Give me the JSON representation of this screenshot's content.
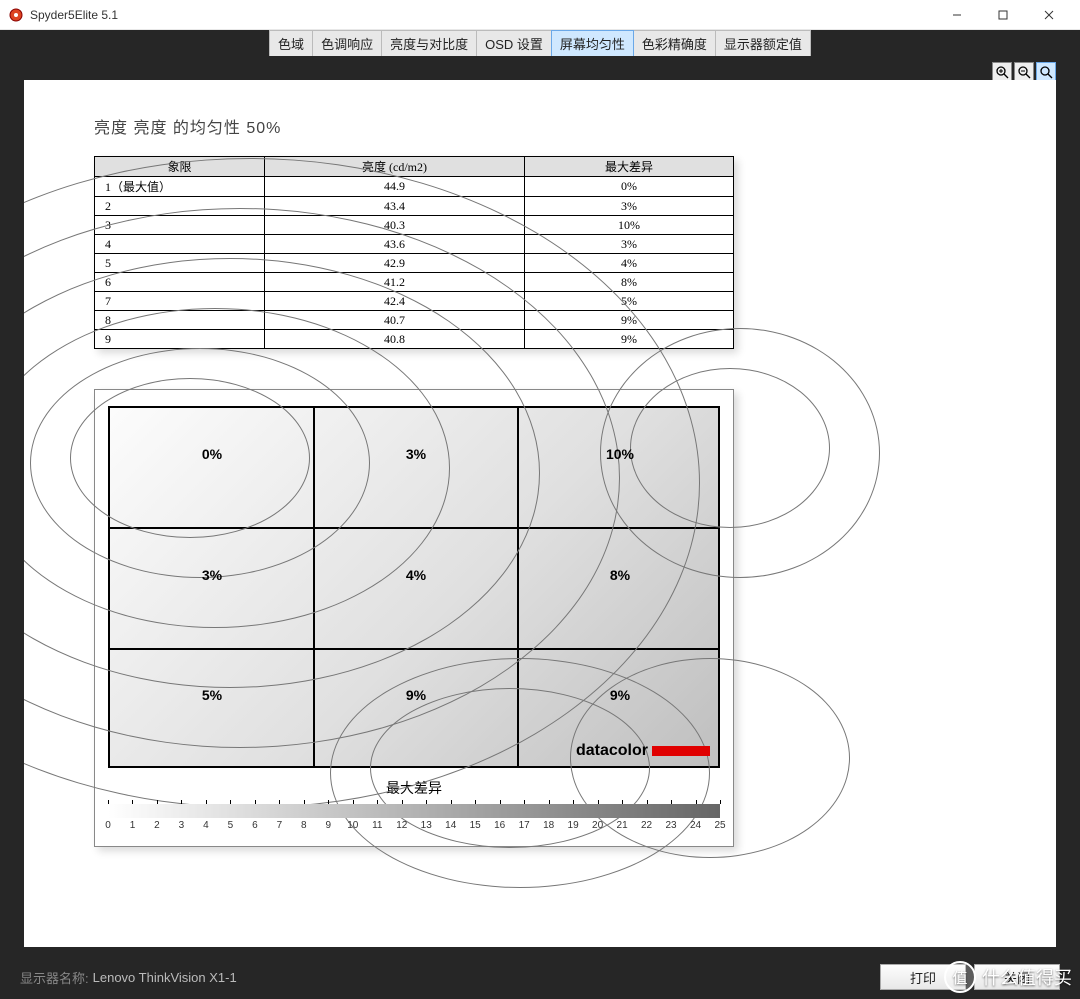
{
  "window": {
    "title": "Spyder5Elite 5.1"
  },
  "tabs": [
    {
      "label": "色域",
      "active": false
    },
    {
      "label": "色调响应",
      "active": false
    },
    {
      "label": "亮度与对比度",
      "active": false
    },
    {
      "label": "OSD 设置",
      "active": false
    },
    {
      "label": "屏幕均匀性",
      "active": true
    },
    {
      "label": "色彩精确度",
      "active": false
    },
    {
      "label": "显示器额定值",
      "active": false
    }
  ],
  "page": {
    "title": "亮度 亮度 的均匀性 50%",
    "table_headers": {
      "quadrant": "象限",
      "luminance": "亮度 (cd/m2)",
      "maxdiff": "最大差异"
    },
    "legend_title": "最大差异",
    "brand": "datacolor"
  },
  "footer": {
    "monitor_label": "显示器名称:",
    "monitor_value": "Lenovo ThinkVision X1-1",
    "print": "打印",
    "close": "关闭"
  },
  "watermark": {
    "badge": "值",
    "text": "什么值得买"
  },
  "chart_data": {
    "type": "table",
    "title": "亮度 亮度 的均匀性 50%",
    "columns": [
      "象限",
      "亮度 (cd/m2)",
      "最大差异"
    ],
    "rows": [
      {
        "quadrant": "1（最大值）",
        "luminance": 44.9,
        "diff_pct": 0
      },
      {
        "quadrant": "2",
        "luminance": 43.4,
        "diff_pct": 3
      },
      {
        "quadrant": "3",
        "luminance": 40.3,
        "diff_pct": 10
      },
      {
        "quadrant": "4",
        "luminance": 43.6,
        "diff_pct": 3
      },
      {
        "quadrant": "5",
        "luminance": 42.9,
        "diff_pct": 4
      },
      {
        "quadrant": "6",
        "luminance": 41.2,
        "diff_pct": 8
      },
      {
        "quadrant": "7",
        "luminance": 42.4,
        "diff_pct": 5
      },
      {
        "quadrant": "8",
        "luminance": 40.7,
        "diff_pct": 9
      },
      {
        "quadrant": "9",
        "luminance": 40.8,
        "diff_pct": 9
      }
    ],
    "grid_diff_pct": [
      [
        0,
        3,
        10
      ],
      [
        3,
        4,
        8
      ],
      [
        5,
        9,
        9
      ]
    ],
    "legend_range": [
      0,
      25
    ],
    "legend_ticks": [
      0,
      1,
      2,
      3,
      4,
      5,
      6,
      7,
      8,
      9,
      10,
      11,
      12,
      13,
      14,
      15,
      16,
      17,
      18,
      19,
      20,
      21,
      22,
      23,
      24,
      25
    ]
  }
}
